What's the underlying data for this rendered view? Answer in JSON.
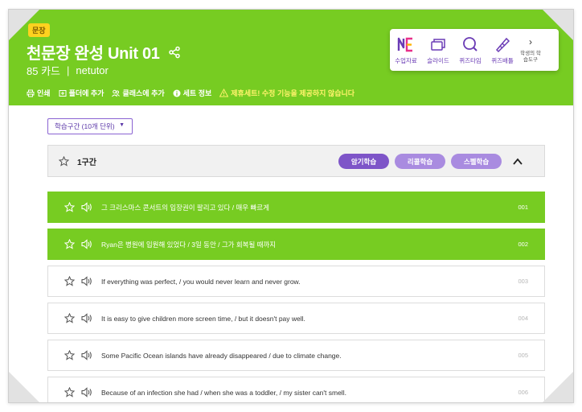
{
  "header": {
    "badge": "문장",
    "title": "천문장 완성 Unit 01",
    "card_count": "85 카드",
    "separator": "|",
    "author": "netutor",
    "bg_color": "#77cc22"
  },
  "actions": [
    {
      "label": "인쇄",
      "icon": "print-icon"
    },
    {
      "label": "폴더에 추가",
      "icon": "folder-add-icon"
    },
    {
      "label": "클래스에 추가",
      "icon": "class-add-icon"
    },
    {
      "label": "세트 정보",
      "icon": "info-icon"
    },
    {
      "label": "제휴세트! 수정 기능을 제공하지 않습니다",
      "icon": "warning-icon"
    }
  ],
  "tools": [
    {
      "label": "수업자료",
      "icon": "ne-logo-icon"
    },
    {
      "label": "슬라이드",
      "icon": "slides-icon"
    },
    {
      "label": "퀴즈타임",
      "icon": "quiz-time-icon"
    },
    {
      "label": "퀴즈배틀",
      "icon": "quiz-battle-icon"
    },
    {
      "label": "학생의 학습도구",
      "icon": "chevron-right-icon",
      "chev": "›"
    }
  ],
  "range_select": {
    "value": "학습구간 (10개 단위)"
  },
  "section": {
    "title": "1구간",
    "buttons": [
      "암기학습",
      "리콜학습",
      "스펠학습"
    ],
    "accent": "#7e55c8"
  },
  "cards": [
    {
      "text": "그 크리스마스 콘서트의 입장권이 팔리고 있다 / 매우 빠르게",
      "num": "001",
      "active": true
    },
    {
      "text": "Ryan은 병원에 입원해 있었다 / 3일 동안 / 그가 회복될 때까지",
      "num": "002",
      "active": true
    },
    {
      "text": "If everything was perfect, / you would never learn and never grow.",
      "num": "003",
      "active": false
    },
    {
      "text": "It is easy to give children more screen time, / but it doesn't pay well.",
      "num": "004",
      "active": false
    },
    {
      "text": "Some Pacific Ocean islands have already disappeared / due to climate change.",
      "num": "005",
      "active": false
    },
    {
      "text": "Because of an infection she had / when she was a toddler, / my sister can't smell.",
      "num": "006",
      "active": false
    }
  ]
}
